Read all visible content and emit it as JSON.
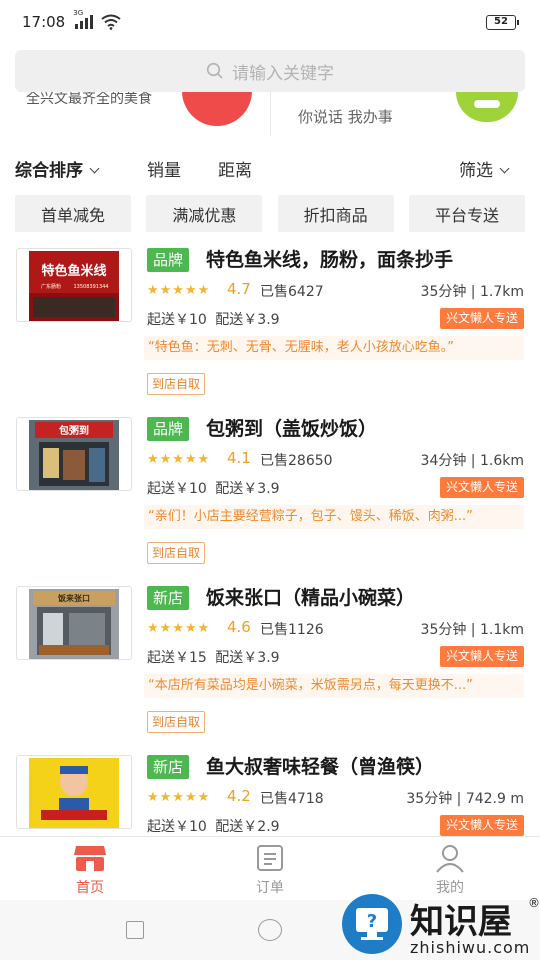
{
  "status": {
    "time": "17:08",
    "network": "3G",
    "battery": "52"
  },
  "search": {
    "placeholder": "请输入关键字"
  },
  "banner": {
    "left_text": "全兴文最齐全的美食",
    "right_text": "你说话 我办事"
  },
  "sort": {
    "items": [
      "综合排序",
      "销量",
      "距离"
    ],
    "filter": "筛选"
  },
  "chips": [
    "首单减免",
    "满减优惠",
    "折扣商品",
    "平台专送"
  ],
  "stores": [
    {
      "tag": "品牌",
      "name": "特色鱼米线，肠粉，面条抄手",
      "rating": "4.7",
      "sold": "已售6427",
      "eta": "35分钟 | 1.7km",
      "min_order": "起送￥10",
      "delivery_fee": "配送￥3.9",
      "delivery_badge": "兴文懒人专送",
      "notice": "“特色鱼：无刺、无骨、无腥味，老人小孩放心吃鱼。”",
      "pickup": "到店自取",
      "stars": 4.5
    },
    {
      "tag": "品牌",
      "name": "包粥到（盖饭炒饭）",
      "rating": "4.1",
      "sold": "已售28650",
      "eta": "34分钟 | 1.6km",
      "min_order": "起送￥10",
      "delivery_fee": "配送￥3.9",
      "delivery_badge": "兴文懒人专送",
      "notice": "“亲们！小店主要经营粽子，包子、馒头、稀饭、肉粥...”",
      "pickup": "到店自取",
      "stars": 4.5
    },
    {
      "tag": "新店",
      "name": "饭来张口（精品小碗菜）",
      "rating": "4.6",
      "sold": "已售1126",
      "eta": "35分钟 | 1.1km",
      "min_order": "起送￥15",
      "delivery_fee": "配送￥3.9",
      "delivery_badge": "兴文懒人专送",
      "notice": "“本店所有菜品均是小碗菜，米饭需另点，每天更换不...”",
      "pickup": "到店自取",
      "stars": 4.5
    },
    {
      "tag": "新店",
      "name": "鱼大叔奢味轻餐（曾渔筷）",
      "rating": "4.2",
      "sold": "已售4718",
      "eta": "35分钟 | 742.9 m",
      "min_order": "起送￥10",
      "delivery_fee": "配送￥2.9",
      "delivery_badge": "兴文懒人专送",
      "notice": "",
      "pickup": "",
      "stars": 4.5
    }
  ],
  "thumb_text": {
    "s1_sign": "特色鱼米线",
    "s1_sub": "广东肠粉",
    "s1_phone": "13508391344",
    "s2_sign": "包粥到",
    "s3_sign": "饭来张口"
  },
  "tabs": [
    {
      "label": "首页",
      "icon": "home-store-icon",
      "active": true
    },
    {
      "label": "订单",
      "icon": "order-list-icon",
      "active": false
    },
    {
      "label": "我的",
      "icon": "profile-icon",
      "active": false
    }
  ],
  "watermark": {
    "title": "知识屋",
    "sub": "zhishiwu.com",
    "reg": "®"
  },
  "colors": {
    "accent": "#f05a4a",
    "brand_tag": "#4cb84f",
    "delivery": "#ff7a3d",
    "rating": "#f0a020"
  }
}
